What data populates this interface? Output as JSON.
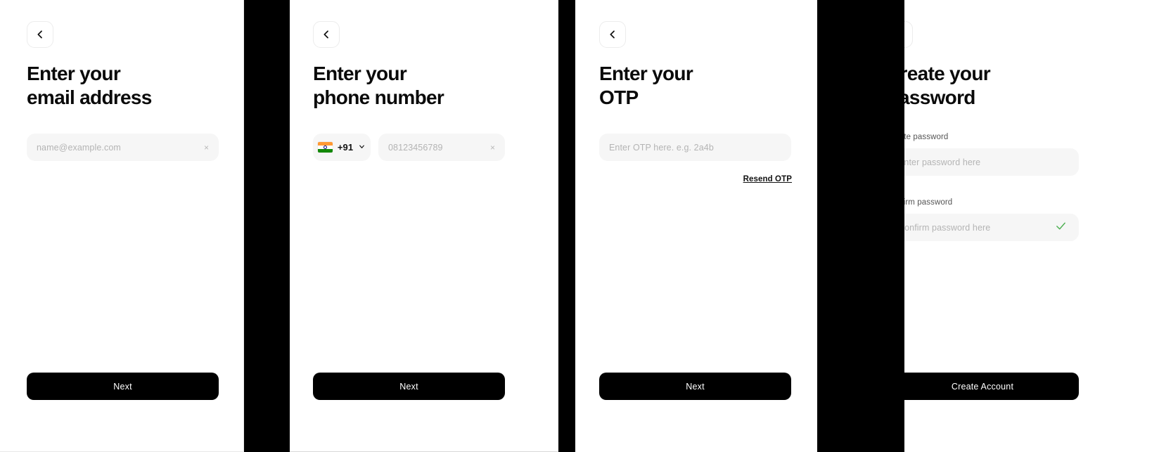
{
  "theme": {
    "page_background": "#000000",
    "panel_background": "#ffffff",
    "field_background": "#f6f6f6",
    "placeholder_color": "#b4b4b4",
    "heading_color": "#0a0a0a",
    "cta_background": "#000000",
    "cta_text_color": "#ffffff",
    "success_color": "#4caf50"
  },
  "screens": [
    {
      "id": "email",
      "back_button": {
        "icon": "chevron-left-icon",
        "label": "Back"
      },
      "heading": "Enter your\nemail address",
      "input": {
        "name": "email-input",
        "placeholder": "name@example.com",
        "value": "",
        "clear_icon": "×"
      },
      "cta": {
        "label": "Next"
      }
    },
    {
      "id": "phone",
      "back_button": {
        "icon": "chevron-left-icon",
        "label": "Back"
      },
      "heading": "Enter your\nphone number",
      "country_select": {
        "flag": "india-flag-icon",
        "dial_code": "+91",
        "chevron": "chevron-down-icon"
      },
      "input": {
        "name": "phone-input",
        "placeholder": "08123456789",
        "value": "",
        "clear_icon": "×"
      },
      "cta": {
        "label": "Next"
      }
    },
    {
      "id": "otp",
      "back_button": {
        "icon": "chevron-left-icon",
        "label": "Back"
      },
      "heading": "Enter your\nOTP",
      "input": {
        "name": "otp-input",
        "placeholder": "Enter OTP here. e.g. 2a4b",
        "value": ""
      },
      "resend_link": "Resend OTP",
      "cta": {
        "label": "Next"
      }
    },
    {
      "id": "password",
      "back_button": {
        "icon": "chevron-left-icon",
        "label": "Back"
      },
      "heading": "Create your\nPassword",
      "create_password": {
        "label": "Create password",
        "placeholder": "Enter password here",
        "value": ""
      },
      "confirm_password": {
        "label": "Confirm password",
        "placeholder": "Confirm password here",
        "value": "",
        "status_icon": "check-icon",
        "status_color": "#4caf50"
      },
      "cta": {
        "label": "Create Account"
      }
    }
  ]
}
